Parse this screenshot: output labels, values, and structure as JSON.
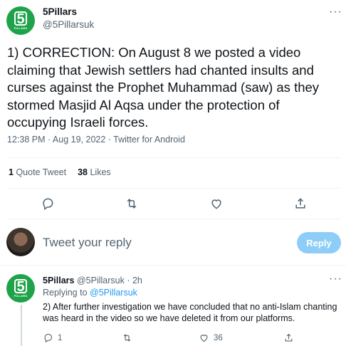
{
  "tweet": {
    "author_name": "5Pillars",
    "author_handle": "@5Pillarsuk",
    "avatar_text_big": "5",
    "avatar_text_small": "PILLARS",
    "more_label": "···",
    "text": "1) CORRECTION: On August 8 we posted a video claiming that Jewish settlers had chanted insults and curses against the Prophet Muhammad (saw) as they stormed Masjid Al Aqsa under the protection of occupying Israeli forces.",
    "meta": "12:38 PM · Aug 19, 2022 · Twitter for Android",
    "quote_count": "1",
    "quote_label": "Quote Tweet",
    "like_count": "38",
    "like_label": "Likes",
    "actions": [
      "reply-icon",
      "retweet-icon",
      "like-icon",
      "share-icon"
    ]
  },
  "composer": {
    "placeholder": "Tweet your reply",
    "reply_button": "Reply"
  },
  "reply": {
    "author_name": "5Pillars",
    "author_handle": "@5Pillarsuk",
    "time": "· 2h",
    "replying_prefix": "Replying to",
    "replying_to": "@5Pillarsuk",
    "text": "2) After further investigation we have concluded that no anti-Islam chanting was heard in the video so we have deleted it from our platforms.",
    "reply_count": "1",
    "retweet_count": "",
    "like_count": "36",
    "more_label": "···"
  },
  "colors": {
    "brand_green": "#1fa34a",
    "twitter_blue": "#1d9bf0",
    "reply_button_disabled": "#8ecdf8",
    "secondary_text": "#536471"
  }
}
